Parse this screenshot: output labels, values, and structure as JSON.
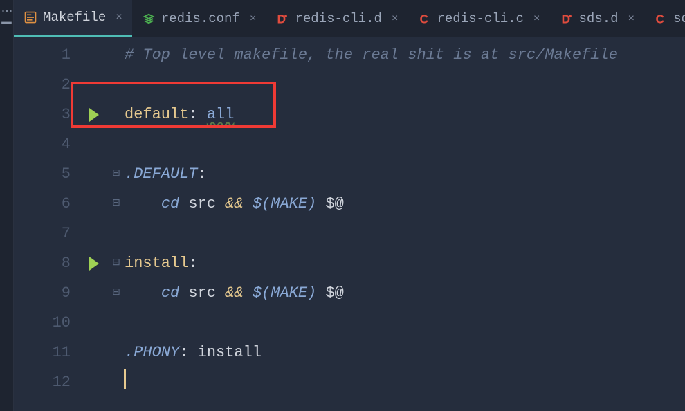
{
  "tabs": [
    {
      "icon": "makefile-icon",
      "label": "Makefile",
      "active": true
    },
    {
      "icon": "conf-icon",
      "label": "redis.conf"
    },
    {
      "icon": "d-red-icon",
      "label": "redis-cli.d"
    },
    {
      "icon": "c-icon",
      "label": "redis-cli.c"
    },
    {
      "icon": "d-red-icon",
      "label": "sds.d"
    },
    {
      "icon": "c-icon",
      "label": "sds.c"
    }
  ],
  "line_numbers": [
    "1",
    "2",
    "3",
    "4",
    "5",
    "6",
    "7",
    "8",
    "9",
    "10",
    "11",
    "12"
  ],
  "code": {
    "l1_comment": "# Top level makefile, the real shit is at src/Makefile",
    "l3_target": "default",
    "l3_colon": ":",
    "l3_dep": "all",
    "l5_special": ".DEFAULT",
    "l5_colon": ":",
    "l6_indent": "    ",
    "l6_cd": "cd",
    "l6_src": " src ",
    "l6_and": "&&",
    "l6_make": " $(MAKE)",
    "l6_at": " $@",
    "l8_target": "install",
    "l8_colon": ":",
    "l9_indent": "    ",
    "l9_cd": "cd",
    "l9_src": " src ",
    "l9_and": "&&",
    "l9_make": " $(MAKE)",
    "l9_at": " $@",
    "l11_phony": ".PHONY",
    "l11_colon": ":",
    "l11_dep": " install"
  }
}
